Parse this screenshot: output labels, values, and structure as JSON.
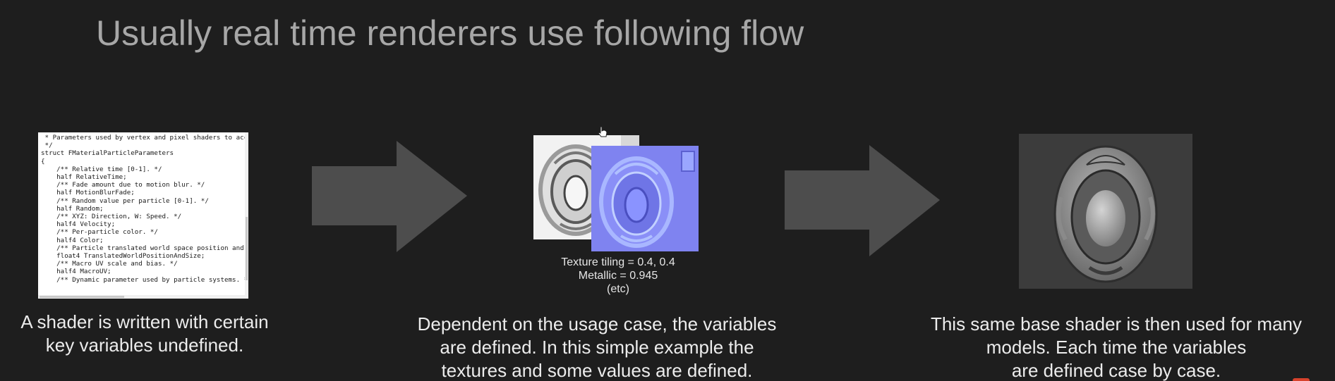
{
  "slide": {
    "title": "Usually real time renderers use following flow"
  },
  "step1": {
    "code_lines": [
      " * Parameters used by vertex and pixel shaders to acce",
      " */",
      "struct FMaterialParticleParameters",
      "{",
      "    /** Relative time [0-1]. */",
      "    half RelativeTime;",
      "    /** Fade amount due to motion blur. */",
      "    half MotionBlurFade;",
      "    /** Random value per particle [0-1]. */",
      "    half Random;",
      "    /** XYZ: Direction, W: Speed. */",
      "    half4 Velocity;",
      "    /** Per-particle color. */",
      "    half4 Color;",
      "    /** Particle translated world space position and s",
      "    float4 TranslatedWorldPositionAndSize;",
      "    /** Macro UV scale and bias. */",
      "    half4 MacroUV;",
      "    /** Dynamic parameter used by particle systems. */"
    ],
    "caption_lines": [
      "A shader is written with certain",
      "key variables undefined."
    ]
  },
  "step2": {
    "texture_lines": [
      "Texture tiling = 0.4, 0.4",
      "Metallic = 0.945",
      "(etc)"
    ],
    "caption_lines": [
      "Dependent on the usage case, the variables",
      "are defined. In this simple example the",
      "textures and some values are defined."
    ]
  },
  "step3": {
    "caption_lines": [
      "This same base shader is then used for many",
      "models. Each time the variables",
      "are defined case by case."
    ]
  },
  "icons": {
    "arrow": "right-arrow-icon",
    "cursor": "hand-cursor-icon"
  },
  "colors": {
    "background": "#1e1e1e",
    "title": "#a7a7a7",
    "arrow": "#4d4d4d",
    "normal_map": "#7f83f0"
  }
}
